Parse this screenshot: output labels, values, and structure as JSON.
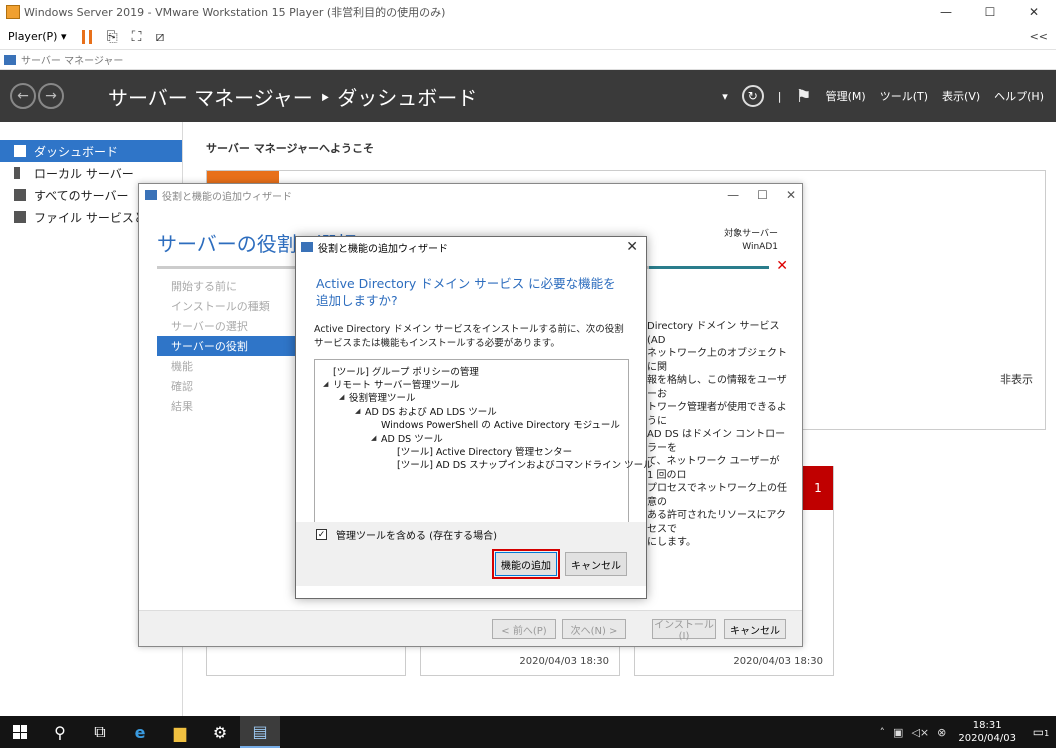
{
  "vm": {
    "title": "Windows Server 2019 - VMware Workstation 15 Player (非営利目的の使用のみ)",
    "player_menu": "Player(P) ▾",
    "collapse": "<<",
    "controls": {
      "minimize": "—",
      "maximize": "☐",
      "close": "✕"
    }
  },
  "server_manager": {
    "window_title": "サーバー マネージャー",
    "breadcrumb": "サーバー マネージャー ‣ ダッシュボード",
    "menus": {
      "manage": "管理(M)",
      "tools": "ツール(T)",
      "view": "表示(V)",
      "help": "ヘルプ(H)"
    },
    "sidebar": [
      {
        "label": "ダッシュボード",
        "active": true
      },
      {
        "label": "ローカル サーバー",
        "active": false
      },
      {
        "label": "すべてのサーバー",
        "active": false
      },
      {
        "label": "ファイル サービスと記憶",
        "active": false
      }
    ],
    "welcome": "サーバー マネージャーへようこそ",
    "hide": "非表示",
    "badge": "1",
    "tiles": [
      {
        "timestamp": ""
      },
      {
        "timestamp": "2020/04/03 18:30"
      },
      {
        "timestamp": "2020/04/03 18:30"
      }
    ]
  },
  "wizard": {
    "title": "役割と機能の追加ウィザード",
    "heading": "サーバーの役割の選択",
    "target_label": "対象サーバー",
    "target_value": "WinAD1",
    "steps": [
      {
        "label": "開始する前に",
        "active": false
      },
      {
        "label": "インストールの種類",
        "active": false
      },
      {
        "label": "サーバーの選択",
        "active": false
      },
      {
        "label": "サーバーの役割",
        "active": true
      },
      {
        "label": "機能",
        "active": false
      },
      {
        "label": "確認",
        "active": false
      },
      {
        "label": "結果",
        "active": false
      }
    ],
    "description": "Directory ドメイン サービス (AD\nネットワーク上のオブジェクトに関\n報を格納し、この情報をユーザーお\nトワーク管理者が使用できるように\nAD DS はドメイン コントローラーを\nて、ネットワーク ユーザーが 1 回のロ\nプロセスでネットワーク上の任意の\nある許可されたリソースにアクセスで\nにします。",
    "buttons": {
      "prev": "< 前へ(P)",
      "next": "次へ(N) >",
      "install": "インストール(I)",
      "cancel": "キャンセル"
    }
  },
  "dialog": {
    "title": "役割と機能の追加ウィザード",
    "question": "Active Directory ドメイン サービス に必要な機能を追加しますか?",
    "body": "Active Directory ドメイン サービスをインストールする前に、次の役割サービスまたは機能もインストールする必要があります。",
    "tree": [
      {
        "text": "[ツール] グループ ポリシーの管理",
        "indent": 1,
        "expand": false
      },
      {
        "text": "リモート サーバー管理ツール",
        "indent": 0,
        "expand": true
      },
      {
        "text": "役割管理ツール",
        "indent": 1,
        "expand": true
      },
      {
        "text": "AD DS および AD LDS ツール",
        "indent": 2,
        "expand": true
      },
      {
        "text": "Windows PowerShell の Active Directory モジュール",
        "indent": 4,
        "expand": false
      },
      {
        "text": "AD DS ツール",
        "indent": 3,
        "expand": true
      },
      {
        "text": "[ツール] Active Directory 管理センター",
        "indent": 5,
        "expand": false
      },
      {
        "text": "[ツール] AD DS スナップインおよびコマンドライン ツール",
        "indent": 5,
        "expand": false
      }
    ],
    "checkbox_label": "管理ツールを含める (存在する場合)",
    "checkbox_checked": true,
    "buttons": {
      "add": "機能の追加",
      "cancel": "キャンセル"
    }
  },
  "taskbar": {
    "time": "18:31",
    "date": "2020/04/03",
    "notifications": "1"
  }
}
